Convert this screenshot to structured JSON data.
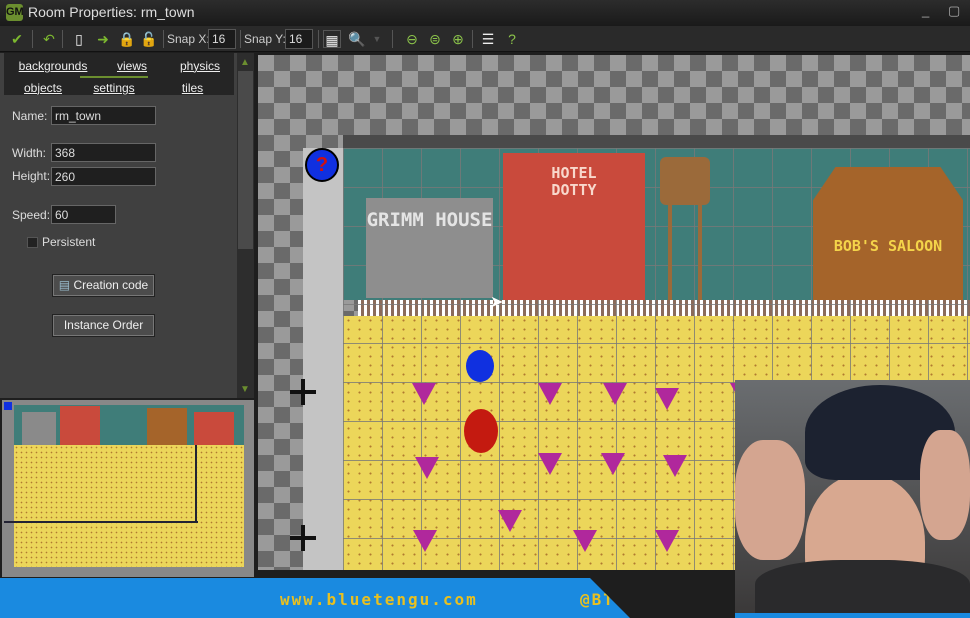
{
  "window": {
    "title": "Room Properties: rm_town",
    "logo": "GM",
    "minimize": "_",
    "close": "▢"
  },
  "toolbar": {
    "snap_x_label": "Snap X:",
    "snap_x": "16",
    "snap_y_label": "Snap Y:",
    "snap_y": "16",
    "icons": [
      "ok-check",
      "undo",
      "new-file",
      "shift-arrow",
      "lock",
      "unlock",
      "grid-toggle",
      "zoom-dropdown",
      "zoom-out",
      "zoom-reset",
      "zoom-in",
      "list",
      "help"
    ]
  },
  "tabs": {
    "row1": [
      "backgrounds",
      "views",
      "physics"
    ],
    "row2": [
      "objects",
      "settings",
      "tiles"
    ],
    "active": "settings"
  },
  "settings": {
    "name_label": "Name:",
    "name": "rm_town",
    "width_label": "Width:",
    "width": "368",
    "height_label": "Height:",
    "height": "260",
    "speed_label": "Speed:",
    "speed": "60",
    "persistent_label": "Persistent",
    "persistent": false,
    "creation_code": "Creation code",
    "instance_order": "Instance Order"
  },
  "room": {
    "buildings": {
      "grimm": "GRIMM HOUSE",
      "hotel": "HOTEL DOTTY",
      "saloon": "BOB'S SALOON"
    },
    "unknown_object": "?"
  },
  "banner": {
    "url": "www.bluetengu.com",
    "handle": "@BTengu"
  },
  "colors": {
    "accent": "#6b8e2f",
    "banner": "#1a8ae0",
    "banner_text": "#e8c020"
  }
}
